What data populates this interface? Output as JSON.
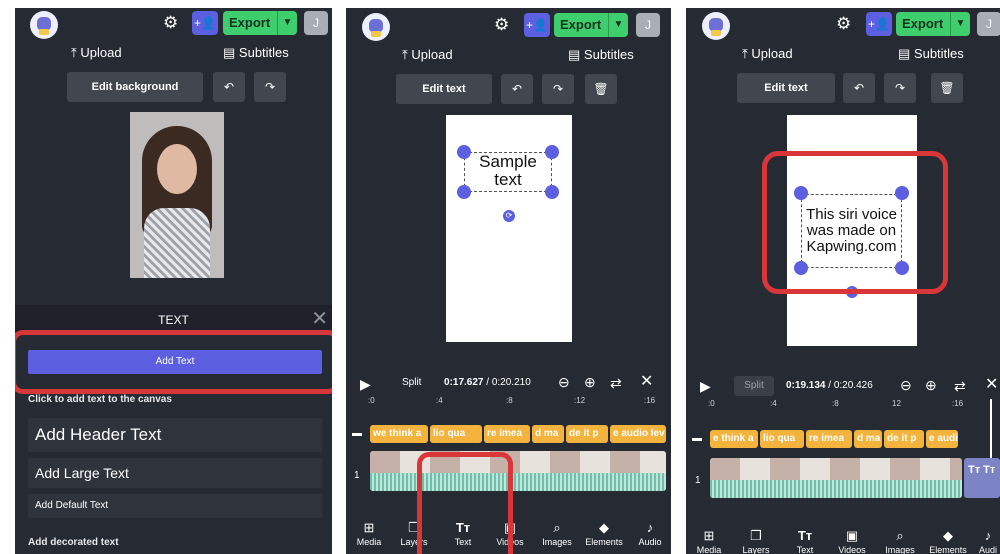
{
  "toolbar": {
    "export_label": "Export",
    "avatar_initial": "J",
    "upload_label": "Upload",
    "subtitles_label": "Subtitles"
  },
  "panel1": {
    "edit_background": "Edit background",
    "text_header": "TEXT",
    "add_text_button": "Add Text",
    "click_hint": "Click to add text to the canvas",
    "presets": [
      "Add Header Text",
      "Add Large Text",
      "Add Default Text"
    ],
    "decorated_label": "Add decorated text"
  },
  "panel2": {
    "edit_text": "Edit text",
    "sample_text": "Sample\ntext",
    "split_label": "Split",
    "time_current": "0:17.627",
    "time_total": "0:20.210",
    "ruler": [
      ":0",
      ":4",
      ":8",
      ":12",
      ":16"
    ],
    "track_labels": [
      "1"
    ],
    "subtitle_clips": [
      "we think a",
      "lio qua",
      "re imea",
      "d ma",
      "de it p",
      "e audio lev"
    ],
    "nav": [
      "Media",
      "Layers",
      "Text",
      "Videos",
      "Images",
      "Elements",
      "Audio"
    ]
  },
  "panel3": {
    "edit_text": "Edit text",
    "canvas_text": "This siri voice\nwas made on\nKapwing.com",
    "split_label": "Split",
    "time_current": "0:19.134",
    "time_total": "0:20.426",
    "ruler": [
      ":0",
      ":4",
      ":8",
      "12",
      ":16"
    ],
    "track_labels": [
      "1"
    ],
    "subtitle_clips": [
      "e think a",
      "lio qua",
      "re imea",
      "d ma",
      "de it p",
      "e audio le"
    ],
    "nav": [
      "Media",
      "Layers",
      "Text",
      "Videos",
      "Images",
      "Elements",
      "Audi"
    ]
  },
  "colors": {
    "panel_bg": "#262a33",
    "accent_purple": "#5b5fe0",
    "export_green": "#3fce6d",
    "highlight_red": "#d9363a",
    "clip_orange": "#f3b33c"
  }
}
